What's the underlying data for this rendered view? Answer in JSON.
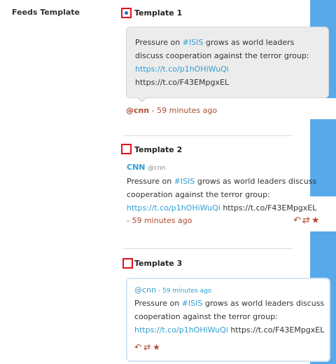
{
  "section_label": "Feeds Template",
  "templates": [
    {
      "title": "Template 1",
      "selected": true,
      "tweet": {
        "text_before": "Pressure on ",
        "hashtag": "#ISIS",
        "text_after": " grows as world leaders discuss cooperation against the terror group:",
        "link": "https://t.co/p1hOHiWuQi",
        "extra_url": "https://t.co/F43EMpgxEL"
      },
      "handle": "@cnn",
      "time": " - 59 minutes ago"
    },
    {
      "title": "Template 2",
      "selected": false,
      "name": "CNN",
      "handle": "@cnn",
      "tweet": {
        "text_before": "Pressure on ",
        "hashtag": "#ISIS",
        "text_after": " grows as world leaders discuss cooperation against the terror group:",
        "link": "https://t.co/p1hOHiWuQi",
        "extra_url": " https://t.co/F43EMpgxEL"
      },
      "time": "- 59 minutes ago"
    },
    {
      "title": "Template 3",
      "selected": false,
      "handle": "@cnn",
      "time": " - 59 minutes ago",
      "tweet": {
        "text_before": "Pressure on ",
        "hashtag": "#ISIS",
        "text_after": " grows as world leaders discuss cooperation against the terror group:",
        "link": "https://t.co/p1hOHiWuQi",
        "extra_url": " https://t.co/F43EMpgxEL"
      }
    }
  ],
  "icons": {
    "reply": "reply-icon",
    "retweet": "retweet-icon",
    "favorite": "star-icon"
  },
  "colors": {
    "accent_blue": "#58a9ea",
    "link": "#2e9fd4",
    "meta": "#b0492f",
    "radio_border": "#e0121b"
  }
}
